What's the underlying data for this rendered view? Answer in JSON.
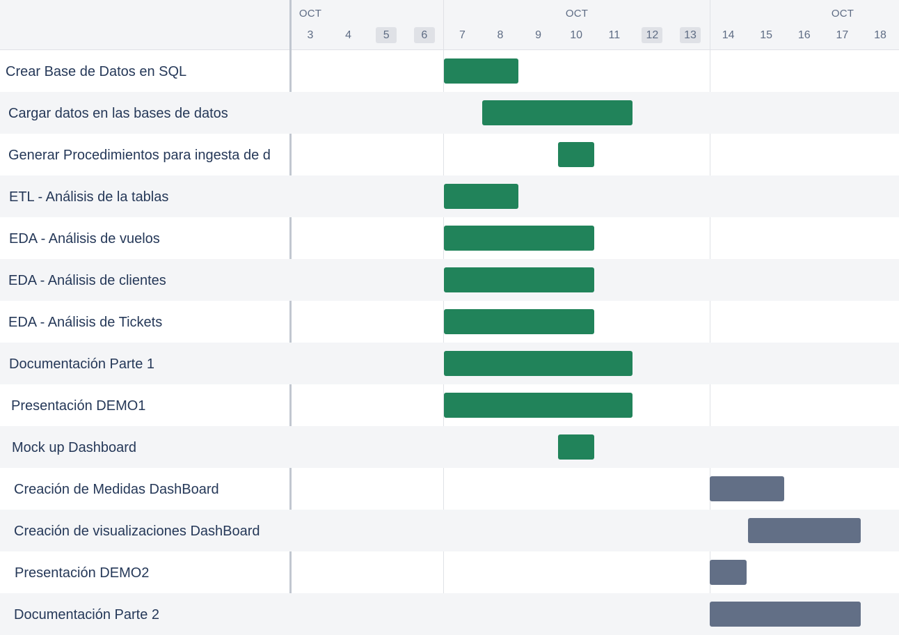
{
  "timeline": {
    "months": [
      "OCT",
      "OCT",
      "OCT"
    ],
    "days": [
      {
        "label": "3",
        "weekend": false
      },
      {
        "label": "4",
        "weekend": false
      },
      {
        "label": "5",
        "weekend": true
      },
      {
        "label": "6",
        "weekend": true
      },
      {
        "label": "7",
        "weekend": false
      },
      {
        "label": "8",
        "weekend": false
      },
      {
        "label": "9",
        "weekend": false
      },
      {
        "label": "10",
        "weekend": false
      },
      {
        "label": "11",
        "weekend": false
      },
      {
        "label": "12",
        "weekend": true
      },
      {
        "label": "13",
        "weekend": true
      },
      {
        "label": "14",
        "weekend": false
      },
      {
        "label": "15",
        "weekend": false
      },
      {
        "label": "16",
        "weekend": false
      },
      {
        "label": "17",
        "weekend": false
      },
      {
        "label": "18",
        "weekend": false
      }
    ]
  },
  "colors": {
    "done": "#21835a",
    "todo": "#626f86"
  },
  "tasks": [
    {
      "name": "Crear Base de Datos en SQL",
      "start": "7",
      "end": "8",
      "status": "done"
    },
    {
      "name": "Cargar datos en las bases de datos",
      "start": "8",
      "end": "11",
      "status": "done"
    },
    {
      "name": "Generar Procedimientos para ingesta de d",
      "start": "10",
      "end": "10",
      "status": "done"
    },
    {
      "name": "ETL - Análisis de la tablas",
      "start": "7",
      "end": "8",
      "status": "done"
    },
    {
      "name": "EDA - Análisis de vuelos",
      "start": "7",
      "end": "10",
      "status": "done"
    },
    {
      "name": "EDA - Análisis de clientes",
      "start": "7",
      "end": "10",
      "status": "done"
    },
    {
      "name": "EDA - Análisis de Tickets",
      "start": "7",
      "end": "10",
      "status": "done"
    },
    {
      "name": "Documentación Parte 1",
      "start": "7",
      "end": "11",
      "status": "done"
    },
    {
      "name": " Presentación DEMO1",
      "start": "7",
      "end": "11",
      "status": "done"
    },
    {
      "name": "Mock up Dashboard",
      "start": "10",
      "end": "10",
      "status": "done"
    },
    {
      "name": "Creación de Medidas DashBoard",
      "start": "14",
      "end": "15",
      "status": "todo"
    },
    {
      "name": "Creación de visualizaciones DashBoard",
      "start": "15",
      "end": "17",
      "status": "todo"
    },
    {
      "name": "Presentación DEMO2",
      "start": "14",
      "end": "14",
      "status": "todo"
    },
    {
      "name": "Documentación Parte 2",
      "start": "14",
      "end": "17",
      "status": "todo"
    }
  ]
}
